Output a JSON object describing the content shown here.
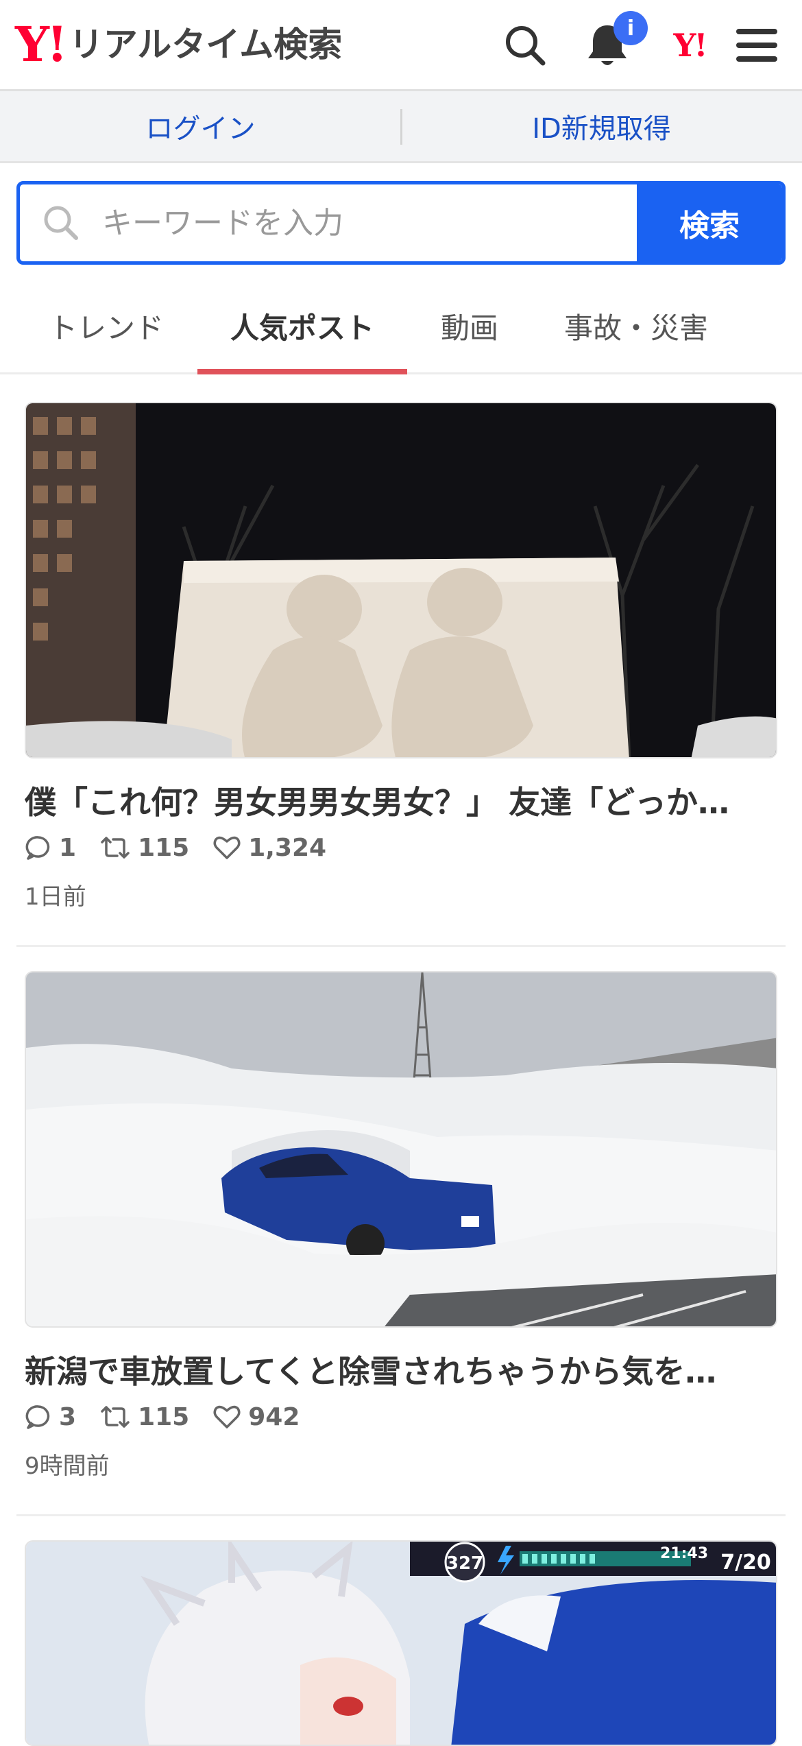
{
  "header": {
    "logo_mark": "Y!",
    "logo_title": "リアルタイム検索",
    "badge": "i",
    "yj_mark": "Y!",
    "icons": [
      "search-icon",
      "bell-icon",
      "yahoo-logo-icon",
      "hamburger-menu-icon"
    ]
  },
  "account": {
    "login_label": "ログイン",
    "register_label": "ID新規取得"
  },
  "search": {
    "placeholder": "キーワードを入力",
    "value": "",
    "button_label": "検索"
  },
  "tabs": [
    {
      "label": "トレンド",
      "active": false
    },
    {
      "label": "人気ポスト",
      "active": true
    },
    {
      "label": "動画",
      "active": false
    },
    {
      "label": "事故・災害",
      "active": false
    }
  ],
  "posts": [
    {
      "title": "僕「これ何？男女男男女男女？」 友達「どっか…",
      "replies": "1",
      "reposts": "115",
      "likes": "1,324",
      "time": "1日前"
    },
    {
      "title": "新潟で車放置してくと除雪されちゃうから気を…",
      "replies": "3",
      "reposts": "115",
      "likes": "942",
      "time": "9時間前"
    },
    {
      "game_hud": {
        "level": "327",
        "time": "21:43",
        "stage": "7/20"
      }
    }
  ],
  "colors": {
    "brand_red": "#ff0033",
    "link_blue": "#1a51c6",
    "search_blue": "#1a62f2",
    "tab_indicator": "#e0525a",
    "badge_blue": "#3b6ef5"
  }
}
